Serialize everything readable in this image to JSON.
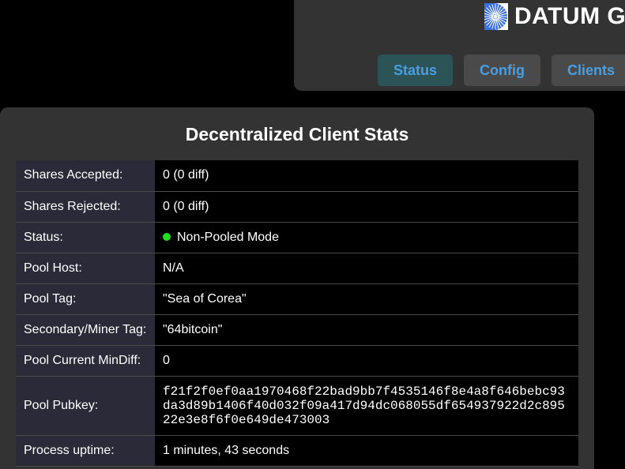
{
  "header": {
    "title": "DATUM G",
    "logo": "datum-logo-icon",
    "nav": [
      {
        "label": "Status",
        "active": true
      },
      {
        "label": "Config",
        "active": false
      },
      {
        "label": "Clients",
        "active": false
      }
    ]
  },
  "stats": {
    "title": "Decentralized Client Stats",
    "rows": {
      "shares_accepted": {
        "label": "Shares Accepted:",
        "value": "0 (0 diff)"
      },
      "shares_rejected": {
        "label": "Shares Rejected:",
        "value": "0 (0 diff)"
      },
      "status": {
        "label": "Status:",
        "value": "Non-Pooled Mode",
        "indicator_color": "#22dd22"
      },
      "pool_host": {
        "label": "Pool Host:",
        "value": "N/A"
      },
      "pool_tag": {
        "label": "Pool Tag:",
        "value": "\"Sea of Corea\""
      },
      "miner_tag": {
        "label": "Secondary/Miner Tag:",
        "value": "\"64bitcoin\""
      },
      "min_diff": {
        "label": "Pool Current MinDiff:",
        "value": "0"
      },
      "pubkey": {
        "label": "Pool Pubkey:",
        "value": "f21f2f0ef0aa1970468f22bad9bb7f4535146f8e4a8f646bebc93da3d89b1406f40d032f09a417d94dc068055df654937922d2c89522e3e8f6f0e649de473003"
      },
      "uptime": {
        "label": "Process uptime:",
        "value": "1 minutes, 43 seconds"
      }
    }
  },
  "colors": {
    "background": "#000000",
    "panel": "#333333",
    "accent": "#4a9ee0",
    "active_tab": "#2c5456",
    "status_ok": "#22dd22"
  }
}
